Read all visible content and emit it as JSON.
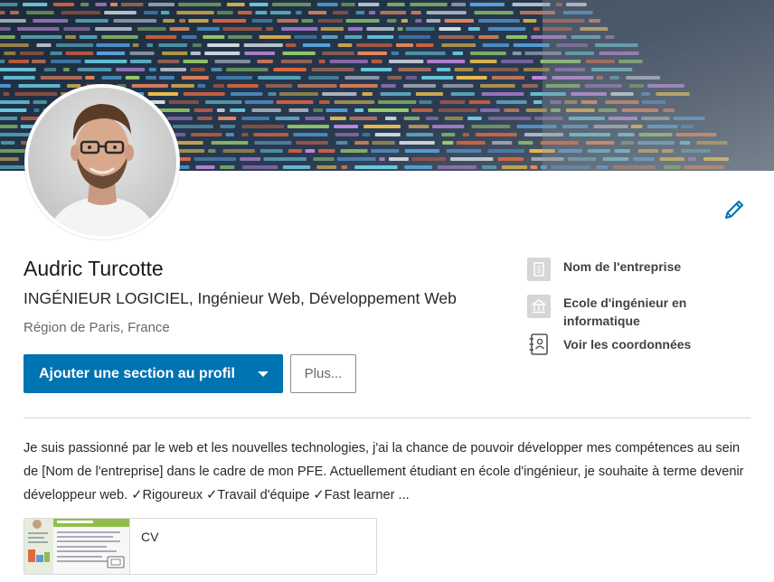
{
  "profile": {
    "name": "Audric Turcotte",
    "headline": "INGÉNIEUR LOGICIEL, Ingénieur Web, Développement Web",
    "location": "Région de Paris, France"
  },
  "actions": {
    "primary_label": "Ajouter une section au profil",
    "more_label": "Plus..."
  },
  "sidebar": {
    "items": [
      {
        "label": "Nom de l'entreprise",
        "icon": "building-icon"
      },
      {
        "label": "Ecole d'ingénieur en informatique",
        "icon": "school-icon"
      },
      {
        "label": "Voir les coordonnées",
        "icon": "contact-book-icon"
      }
    ]
  },
  "summary": {
    "text": "Je suis passionné par le web et les nouvelles technologies, j'ai la chance de pouvoir développer mes compétences au sein de [Nom de l'entreprise] dans le cadre de mon PFE. Actuellement étudiant en école d'ingénieur, je souhaite à terme devenir développeur web. ✓Rigoureux ✓Travail d'équipe ✓Fast learner ..."
  },
  "attachment": {
    "title": "CV"
  },
  "colors": {
    "primary": "#0073b1",
    "edit_icon": "#0073b1",
    "divider": "#d5d5d5"
  }
}
